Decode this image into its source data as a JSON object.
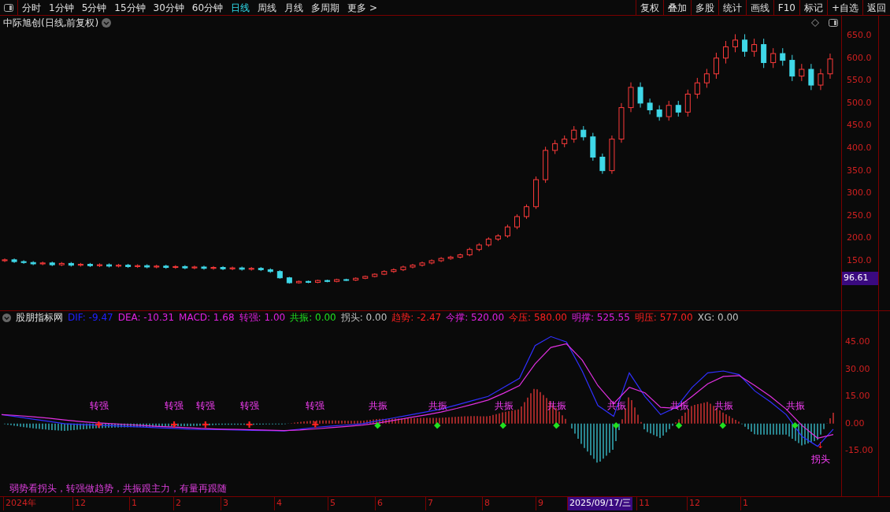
{
  "toolbar": {
    "periods": [
      {
        "label": "分时",
        "selected": false
      },
      {
        "label": "1分钟",
        "selected": false
      },
      {
        "label": "5分钟",
        "selected": false
      },
      {
        "label": "15分钟",
        "selected": false
      },
      {
        "label": "30分钟",
        "selected": false
      },
      {
        "label": "60分钟",
        "selected": false
      },
      {
        "label": "日线",
        "selected": true
      },
      {
        "label": "周线",
        "selected": false
      },
      {
        "label": "月线",
        "selected": false
      },
      {
        "label": "多周期",
        "selected": false
      },
      {
        "label": "更多 >",
        "selected": false
      }
    ],
    "actions": [
      "复权",
      "叠加",
      "多股",
      "统计",
      "画线",
      "F10",
      "标记",
      "+自选",
      "返回"
    ]
  },
  "main_chart": {
    "title": "中际旭创(日线,前复权)",
    "last_price": "96.61",
    "chart_data": {
      "type": "candlestick",
      "ylim": [
        38,
        694
      ],
      "yticks": [
        {
          "value": 650,
          "label": "650.0"
        },
        {
          "value": 600,
          "label": "600.0"
        },
        {
          "value": 550,
          "label": "550.0"
        },
        {
          "value": 500,
          "label": "500.0"
        },
        {
          "value": 450,
          "label": "450.0"
        },
        {
          "value": 400,
          "label": "400.0"
        },
        {
          "value": 350,
          "label": "350.0"
        },
        {
          "value": 300,
          "label": "300.0"
        },
        {
          "value": 250,
          "label": "250.0"
        },
        {
          "value": 200,
          "label": "200.0"
        },
        {
          "value": 150,
          "label": "150.0"
        }
      ],
      "ohlc": [
        [
          150,
          155,
          147,
          152
        ],
        [
          152,
          155,
          145,
          148
        ],
        [
          148,
          151,
          143,
          146
        ],
        [
          146,
          149,
          140,
          143
        ],
        [
          143,
          148,
          140,
          145
        ],
        [
          145,
          148,
          138,
          141
        ],
        [
          141,
          147,
          138,
          144
        ],
        [
          144,
          147,
          137,
          140
        ],
        [
          140,
          145,
          137,
          142
        ],
        [
          142,
          145,
          136,
          139
        ],
        [
          139,
          144,
          136,
          141
        ],
        [
          141,
          144,
          135,
          138
        ],
        [
          138,
          143,
          135,
          140
        ],
        [
          140,
          143,
          134,
          137
        ],
        [
          137,
          142,
          134,
          139
        ],
        [
          139,
          142,
          133,
          136
        ],
        [
          136,
          141,
          133,
          138
        ],
        [
          138,
          141,
          132,
          135
        ],
        [
          135,
          140,
          132,
          137
        ],
        [
          137,
          140,
          131,
          134
        ],
        [
          134,
          139,
          131,
          136
        ],
        [
          136,
          139,
          130,
          133
        ],
        [
          133,
          138,
          130,
          135
        ],
        [
          135,
          138,
          129,
          132
        ],
        [
          132,
          137,
          129,
          134
        ],
        [
          134,
          137,
          128,
          131
        ],
        [
          131,
          136,
          128,
          133
        ],
        [
          133,
          136,
          127,
          130
        ],
        [
          130,
          133,
          123,
          126
        ],
        [
          126,
          129,
          110,
          112
        ],
        [
          112,
          114,
          99,
          101
        ],
        [
          101,
          106,
          99,
          104
        ],
        [
          104,
          106,
          100,
          102
        ],
        [
          102,
          108,
          100,
          106
        ],
        [
          106,
          108,
          102,
          104
        ],
        [
          104,
          110,
          102,
          108
        ],
        [
          108,
          110,
          105,
          107
        ],
        [
          107,
          113,
          105,
          111
        ],
        [
          111,
          117,
          109,
          115
        ],
        [
          115,
          122,
          113,
          120
        ],
        [
          120,
          129,
          118,
          126
        ],
        [
          126,
          133,
          123,
          130
        ],
        [
          130,
          139,
          127,
          136
        ],
        [
          136,
          143,
          133,
          140
        ],
        [
          140,
          148,
          137,
          145
        ],
        [
          145,
          153,
          142,
          150
        ],
        [
          150,
          158,
          147,
          155
        ],
        [
          155,
          161,
          152,
          158
        ],
        [
          158,
          166,
          155,
          163
        ],
        [
          163,
          179,
          160,
          175
        ],
        [
          175,
          189,
          171,
          185
        ],
        [
          185,
          202,
          181,
          198
        ],
        [
          198,
          209,
          194,
          205
        ],
        [
          205,
          230,
          201,
          225
        ],
        [
          225,
          253,
          220,
          248
        ],
        [
          248,
          275,
          243,
          270
        ],
        [
          270,
          337,
          265,
          330
        ],
        [
          330,
          403,
          323,
          395
        ],
        [
          395,
          418,
          387,
          410
        ],
        [
          410,
          428,
          402,
          420
        ],
        [
          420,
          449,
          412,
          440
        ],
        [
          440,
          449,
          417,
          425
        ],
        [
          425,
          434,
          372,
          380
        ],
        [
          380,
          388,
          343,
          350
        ],
        [
          350,
          428,
          343,
          420
        ],
        [
          420,
          500,
          412,
          490
        ],
        [
          490,
          546,
          480,
          535
        ],
        [
          535,
          546,
          490,
          500
        ],
        [
          500,
          510,
          475,
          485
        ],
        [
          485,
          495,
          461,
          470
        ],
        [
          470,
          505,
          461,
          495
        ],
        [
          495,
          505,
          470,
          480
        ],
        [
          480,
          530,
          470,
          520
        ],
        [
          520,
          556,
          510,
          545
        ],
        [
          545,
          576,
          534,
          565
        ],
        [
          565,
          612,
          554,
          600
        ],
        [
          600,
          638,
          588,
          625
        ],
        [
          625,
          653,
          613,
          640
        ],
        [
          640,
          653,
          603,
          615
        ],
        [
          615,
          643,
          603,
          630
        ],
        [
          630,
          643,
          578,
          590
        ],
        [
          590,
          622,
          578,
          610
        ],
        [
          610,
          622,
          583,
          595
        ],
        [
          595,
          607,
          549,
          560
        ],
        [
          560,
          587,
          549,
          575
        ],
        [
          575,
          587,
          529,
          540
        ],
        [
          540,
          576,
          529,
          565
        ],
        [
          565,
          610,
          554,
          598
        ]
      ]
    }
  },
  "indicator": {
    "name": "股朋指标网",
    "legend": [
      {
        "label": "DIF: -9.47",
        "color": "#2020ff"
      },
      {
        "label": "DEA: -10.31",
        "color": "#e020e0"
      },
      {
        "label": "MACD: 1.68",
        "color": "#e020e0"
      },
      {
        "label": "转强: 1.00",
        "color": "#e020e0"
      },
      {
        "label": "共振: 0.00",
        "color": "#20e020"
      },
      {
        "label": "拐头: 0.00",
        "color": "#c0c0c0"
      },
      {
        "label": "趋势: -2.47",
        "color": "#ff2020"
      },
      {
        "label": "今撑: 520.00",
        "color": "#e020e0"
      },
      {
        "label": "今压: 580.00",
        "color": "#ff2020"
      },
      {
        "label": "明撑: 525.55",
        "color": "#e020e0"
      },
      {
        "label": "明压: 577.00",
        "color": "#ff2020"
      },
      {
        "label": "XG: 0.00",
        "color": "#c0c0c0"
      }
    ],
    "chart_data": {
      "type": "line",
      "ylim": [
        -40,
        62
      ],
      "yticks": [
        {
          "value": 45,
          "label": "45.00"
        },
        {
          "value": 30,
          "label": "30.00"
        },
        {
          "value": 15,
          "label": "15.00"
        },
        {
          "value": 0,
          "label": "0.00"
        },
        {
          "value": -15,
          "label": "-15.00"
        }
      ],
      "series": [
        {
          "color": "#3030ff",
          "values": [
            5,
            3.8,
            2.5,
            1.3,
            0,
            -0.4,
            -0.8,
            -1.1,
            -1.5,
            -1.9,
            -2.3,
            -2.6,
            -3,
            -3.2,
            -3.3,
            -3.5,
            -3.7,
            -3.8,
            -4,
            -3,
            -2,
            -1.3,
            -0.7,
            0,
            1.6,
            3.2,
            4.8,
            6.4,
            8,
            10.3,
            12.7,
            15,
            20,
            25,
            43,
            48,
            45,
            29,
            10,
            4,
            28,
            15,
            5,
            9,
            20,
            28,
            29,
            27,
            18,
            12,
            5,
            -7,
            -12.5,
            -3
          ]
        },
        {
          "color": "#e030e0",
          "values": [
            5,
            4.5,
            3.8,
            3,
            2,
            1.2,
            0.5,
            0,
            -0.5,
            -1,
            -1.5,
            -1.9,
            -2.3,
            -2.7,
            -3,
            -3.2,
            -3.4,
            -3.6,
            -3.8,
            -3.5,
            -2.9,
            -2.2,
            -1.5,
            -0.8,
            0.3,
            1.8,
            3.3,
            4.8,
            6.4,
            8.4,
            10.6,
            13,
            16.8,
            21,
            33,
            42,
            44,
            35,
            21,
            11,
            20,
            17,
            9,
            8.5,
            15,
            22,
            26,
            26.5,
            21,
            15,
            8,
            -1,
            -8,
            -6
          ]
        }
      ]
    },
    "signals": [
      {
        "text": "转强",
        "kind": "turn",
        "marker": "✚"
      },
      {
        "text": "转强",
        "kind": "turn",
        "marker": "✚"
      },
      {
        "text": "转强",
        "kind": "turn",
        "marker": "✚"
      },
      {
        "text": "转强",
        "kind": "turn",
        "marker": "✚"
      },
      {
        "text": "转强",
        "kind": "turn",
        "marker": "✚"
      },
      {
        "text": "共振",
        "kind": "resonance",
        "marker": "◆"
      },
      {
        "text": "共振",
        "kind": "resonance",
        "marker": "◆"
      },
      {
        "text": "共振",
        "kind": "resonance",
        "marker": "◆"
      },
      {
        "text": "共振",
        "kind": "resonance",
        "marker": "◆"
      },
      {
        "text": "共振",
        "kind": "resonance",
        "marker": "◆"
      },
      {
        "text": "共振",
        "kind": "resonance",
        "marker": "◆"
      },
      {
        "text": "共振",
        "kind": "resonance",
        "marker": "◆"
      },
      {
        "text": "共振",
        "kind": "resonance",
        "marker": "◆"
      },
      {
        "text": "拐头",
        "kind": "hook",
        "marker": "↓"
      }
    ],
    "note": "弱势看拐头，转强做趋势，共振跟主力，有量再跟随"
  },
  "date_axis": [
    {
      "label": "2024年",
      "selected": false
    },
    {
      "label": "12",
      "selected": false
    },
    {
      "label": "1",
      "selected": false
    },
    {
      "label": "2",
      "selected": false
    },
    {
      "label": "3",
      "selected": false
    },
    {
      "label": "4",
      "selected": false
    },
    {
      "label": "5",
      "selected": false
    },
    {
      "label": "6",
      "selected": false
    },
    {
      "label": "7",
      "selected": false
    },
    {
      "label": "8",
      "selected": false
    },
    {
      "label": "9",
      "selected": false
    },
    {
      "label": "2025/09/17/三",
      "selected": true
    },
    {
      "label": "11",
      "selected": false
    },
    {
      "label": "12",
      "selected": false
    },
    {
      "label": "1",
      "selected": false
    }
  ]
}
